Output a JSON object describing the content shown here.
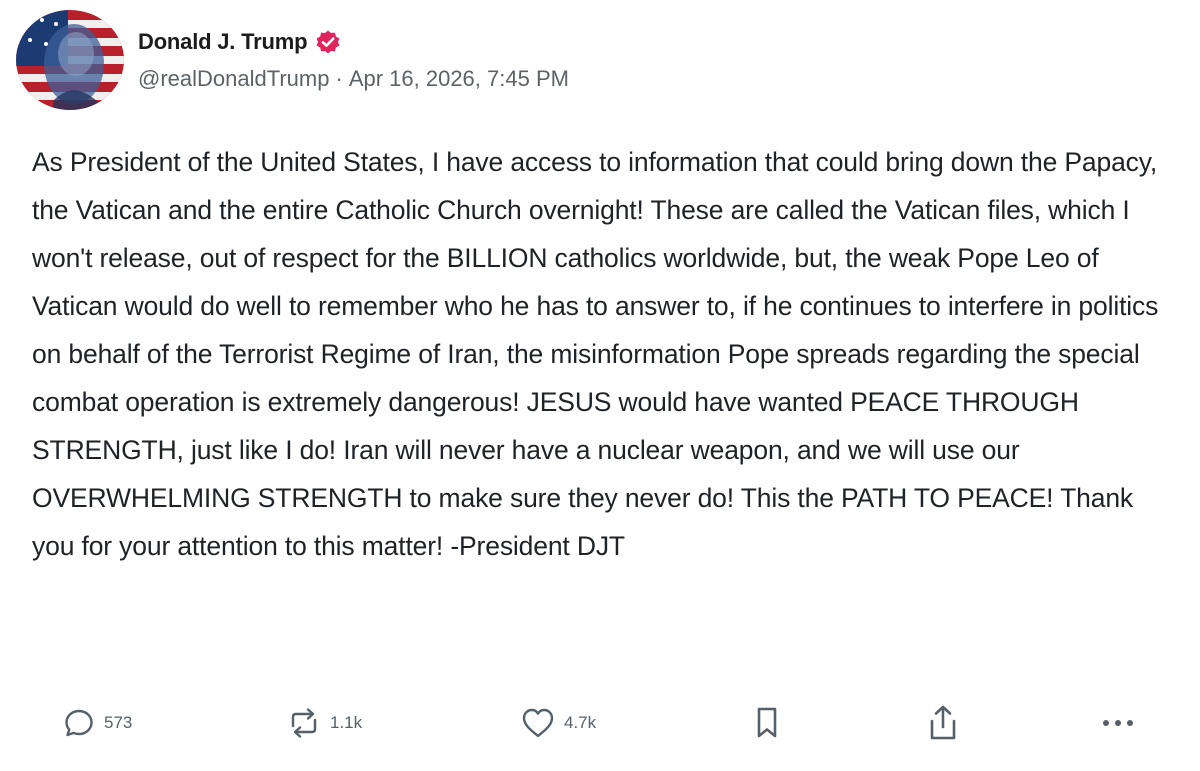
{
  "post": {
    "author": {
      "display_name": "Donald J. Trump",
      "handle": "@realDonaldTrump",
      "separator": "·",
      "timestamp": "Apr 16, 2026, 7:45 PM",
      "verified_color": "#e0245e"
    },
    "body": "As President of the United States, I have access to information that could bring down the Papacy, the Vatican and the entire Catholic Church overnight! These are called the Vatican files, which I won't release, out of respect for the BILLION catholics worldwide, but, the weak Pope Leo of Vatican would do well to remember who he has to answer to, if he continues to interfere in politics on behalf of the Terrorist Regime of Iran, the misinformation Pope spreads regarding the special combat operation is extremely dangerous! JESUS would have wanted PEACE THROUGH STRENGTH, just like I do! Iran will never have a nuclear weapon, and we will use our OVERWHELMING STRENGTH to make sure they never do! This the PATH TO PEACE! Thank you for your attention to this matter! -President DJT",
    "actions": {
      "reply": {
        "icon": "reply-icon",
        "count": "573"
      },
      "repost": {
        "icon": "repost-icon",
        "count": "1.1k"
      },
      "like": {
        "icon": "heart-icon",
        "count": "4.7k"
      },
      "bookmark": {
        "icon": "bookmark-icon"
      },
      "share": {
        "icon": "share-icon"
      },
      "more": {
        "icon": "more-icon"
      }
    },
    "colors": {
      "text": "#1f2226",
      "muted": "#5d6268",
      "icon": "#56606b"
    }
  }
}
